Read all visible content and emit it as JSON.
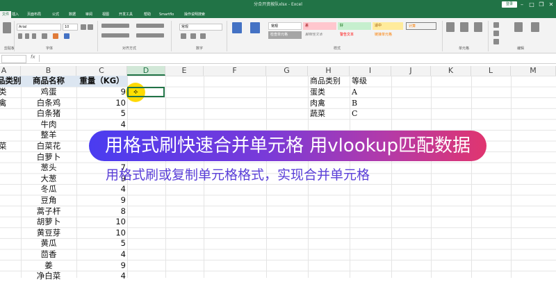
{
  "window": {
    "title": "分合开资按队xlsx - Excel",
    "login_label": "登录"
  },
  "ribbon": {
    "tabs": [
      "文件",
      "插入",
      "页面布局",
      "公式",
      "数据",
      "审阅",
      "视图",
      "开发工具",
      "帮助",
      "Smartflo",
      "操作说明搜索"
    ],
    "active_tab_index": 0,
    "font_name": "Arial",
    "font_size": "10",
    "number_format": "常规",
    "styles": [
      "常规",
      "差",
      "好",
      "适中",
      "检查单元格",
      "解释性文本",
      "警告文本",
      "链接单元格",
      "计算"
    ],
    "group_labels": [
      "剪贴板",
      "字体",
      "对齐方式",
      "数字",
      "样式",
      "单元格",
      "编辑"
    ]
  },
  "formula_bar": {
    "name_box": "",
    "fx_label": "fx",
    "value": ""
  },
  "columns": [
    "A",
    "B",
    "C",
    "D",
    "E",
    "F",
    "G",
    "H",
    "I",
    "J",
    "K",
    "L",
    "M"
  ],
  "selected_column": "D",
  "table": {
    "headers": {
      "a": "品类别",
      "b": "商品名称",
      "c": "重量（KG）"
    },
    "rows": [
      {
        "a": "类",
        "b": "鸡蛋",
        "c": "9"
      },
      {
        "a": "禽",
        "b": "白条鸡",
        "c": "10"
      },
      {
        "a": "",
        "b": "白条猪",
        "c": "5"
      },
      {
        "a": "",
        "b": "牛肉",
        "c": "4"
      },
      {
        "a": "",
        "b": "整羊",
        "c": ""
      },
      {
        "a": "菜",
        "b": "白菜花",
        "c": ""
      },
      {
        "a": "",
        "b": "白萝卜",
        "c": ""
      },
      {
        "a": "",
        "b": "葱头",
        "c": "7"
      },
      {
        "a": "",
        "b": "大葱",
        "c": "9"
      },
      {
        "a": "",
        "b": "冬瓜",
        "c": "4"
      },
      {
        "a": "",
        "b": "豆角",
        "c": "9"
      },
      {
        "a": "",
        "b": "蒿子杆",
        "c": "8"
      },
      {
        "a": "",
        "b": "胡萝卜",
        "c": "10"
      },
      {
        "a": "",
        "b": "黄豆芽",
        "c": "10"
      },
      {
        "a": "",
        "b": "黄瓜",
        "c": "5"
      },
      {
        "a": "",
        "b": "茴香",
        "c": "4"
      },
      {
        "a": "",
        "b": "姜",
        "c": "9"
      },
      {
        "a": "",
        "b": "净白菜",
        "c": "4"
      }
    ]
  },
  "lookup_table": {
    "headers": {
      "h": "商品类别",
      "i": "等级"
    },
    "rows": [
      {
        "h": "蛋类",
        "i": "A"
      },
      {
        "h": "肉禽",
        "i": "B"
      },
      {
        "h": "蔬菜",
        "i": "C"
      }
    ]
  },
  "overlay": {
    "banner": "用格式刷快速合并单元格 用vlookup匹配数据",
    "subtitle": "用格式刷或复制单元格格式，实现合并单元格"
  }
}
